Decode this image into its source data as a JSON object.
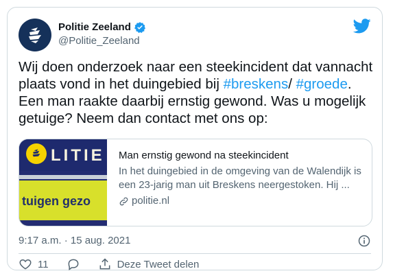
{
  "author": {
    "display_name": "Politie Zeeland",
    "handle": "@Politie_Zeeland",
    "verified": true
  },
  "tweet": {
    "text_before": "Wij doen onderzoek naar een steekincident dat vannacht plaats vond in het duingebied bij ",
    "hashtag1": "#breskens",
    "text_between": "/ ",
    "hashtag2": "#groede",
    "text_after": ". Een man raakte daarbij ernstig gewond. Was u mogelijk getuige? Neem dan contact met ons op:"
  },
  "link_card": {
    "title": "Man ernstig gewond na steekincident",
    "description": "In het duingebied in de omgeving van de Walendijk is een 23-jarig man uit Breskens neergestoken. Hij ...",
    "domain": "politie.nl",
    "thumb_word": "LITIE",
    "thumb_band": "tuigen gezo"
  },
  "timestamp": "9:17 a.m. · 15 aug. 2021",
  "actions": {
    "like_count": "11",
    "share_label": "Deze Tweet delen"
  },
  "colors": {
    "accent": "#1d9bf0",
    "text": "#0f1419",
    "muted": "#536471",
    "border": "#cfd9de"
  },
  "icons": [
    "police-logo-icon",
    "verified-badge-icon",
    "twitter-bird-icon",
    "link-icon",
    "info-icon",
    "heart-icon",
    "reply-icon",
    "share-icon"
  ]
}
